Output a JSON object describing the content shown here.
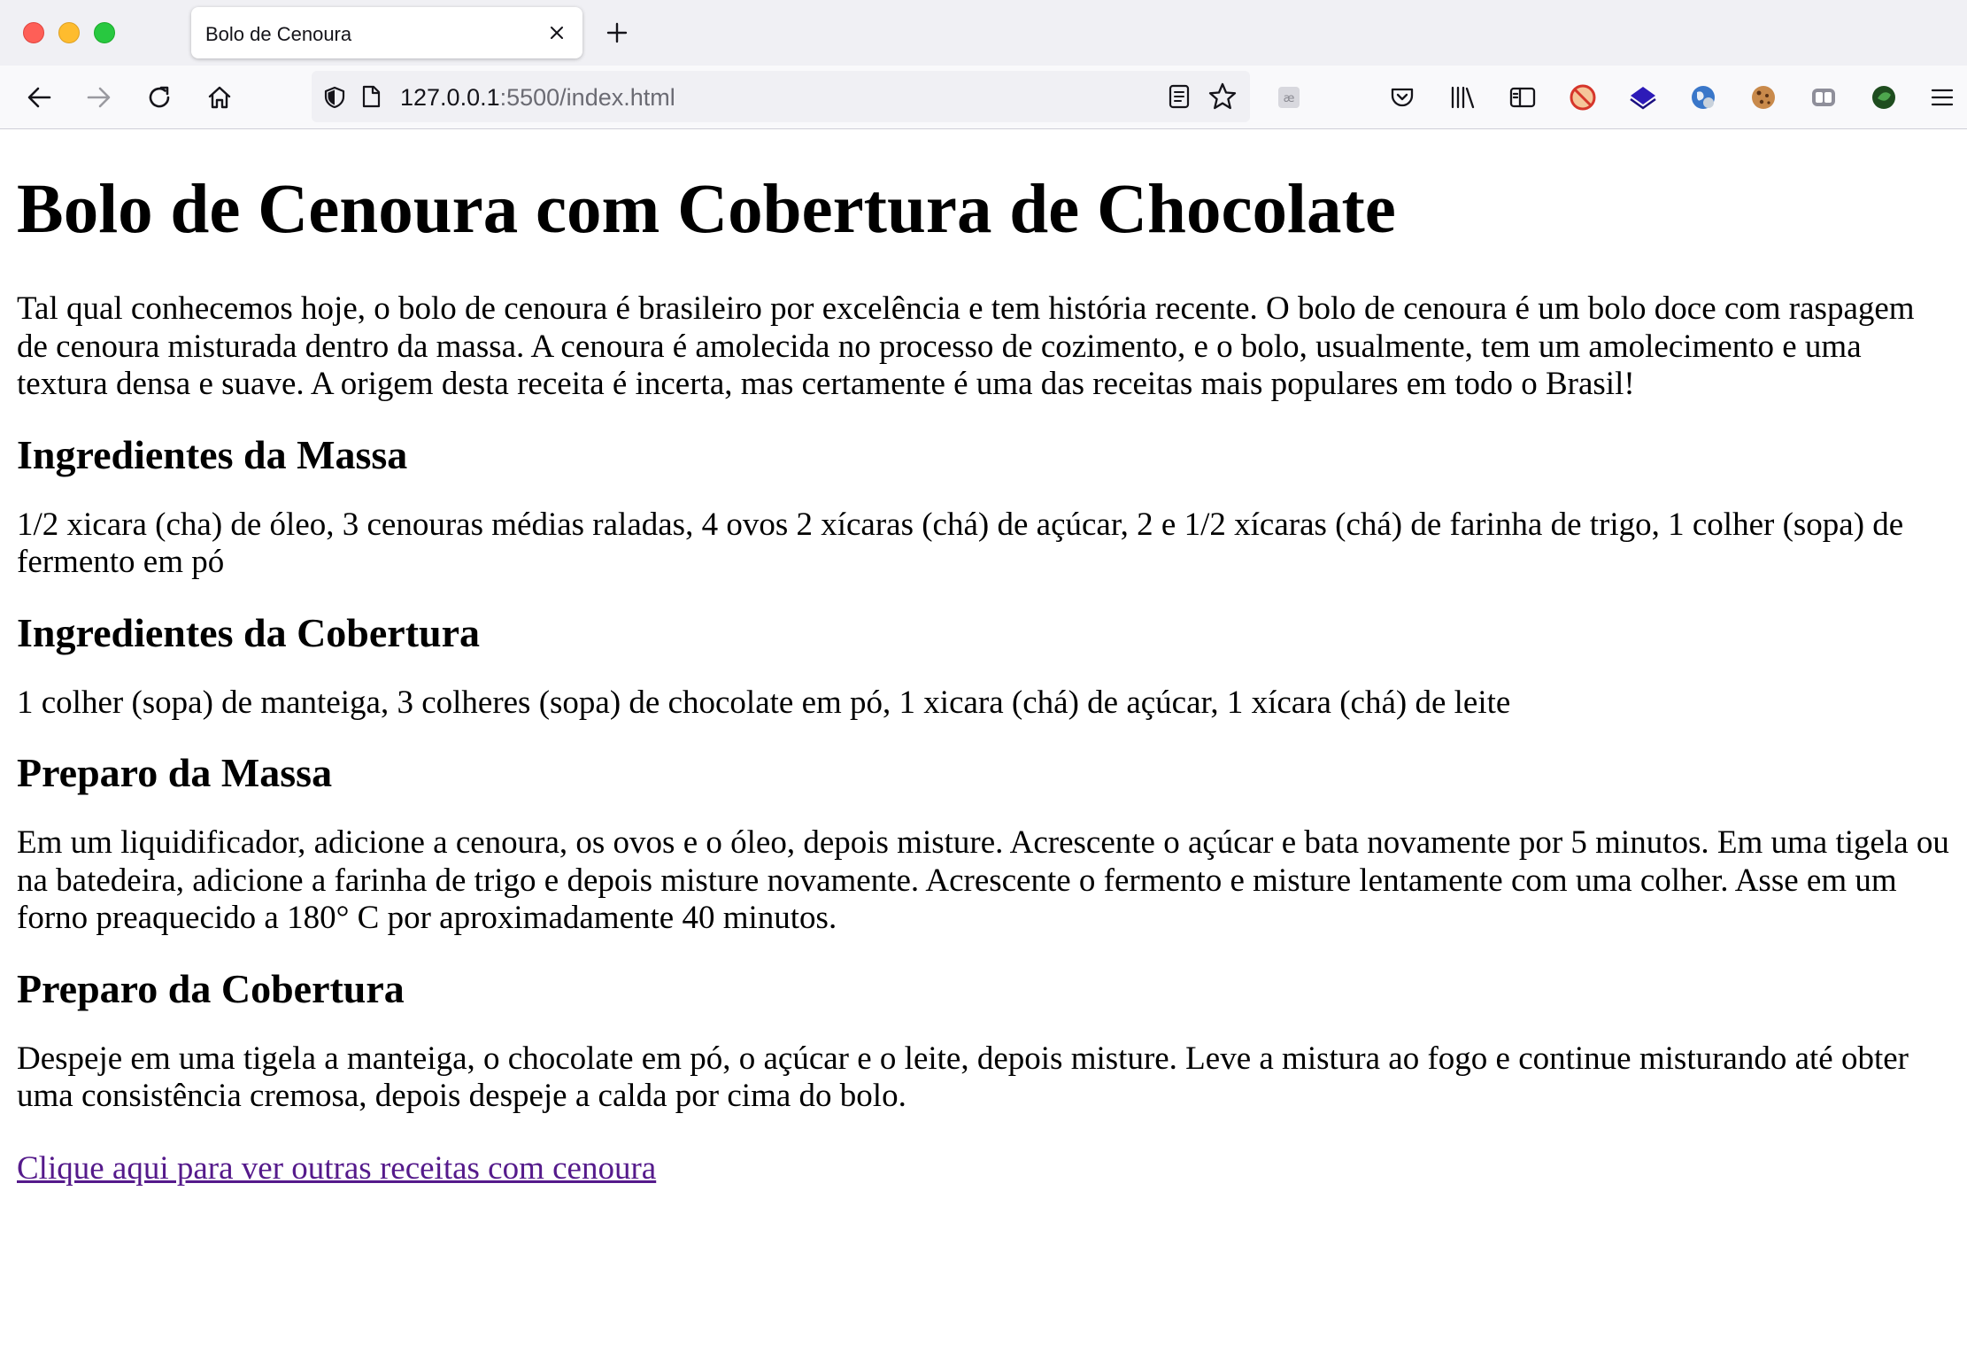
{
  "browser": {
    "tab_title": "Bolo de Cenoura",
    "url_host": "127.0.0.1",
    "url_rest": ":5500/index.html"
  },
  "page": {
    "title": "Bolo de Cenoura com Cobertura de Chocolate",
    "intro": "Tal qual conhecemos hoje, o bolo de cenoura é brasileiro por excelência e tem história recente. O bolo de cenoura é um bolo doce com raspagem de cenoura misturada dentro da massa. A cenoura é amolecida no processo de cozimento, e o bolo, usualmente, tem um amolecimento e uma textura densa e suave. A origem desta receita é incerta, mas certamente é uma das receitas mais populares em todo o Brasil!",
    "sections": [
      {
        "heading": "Ingredientes da Massa",
        "text": "1/2 xicara (cha) de óleo, 3 cenouras médias raladas, 4 ovos 2 xícaras (chá) de açúcar, 2 e 1/2 xícaras (chá) de farinha de trigo, 1 colher (sopa) de fermento em pó"
      },
      {
        "heading": "Ingredientes da Cobertura",
        "text": "1 colher (sopa) de manteiga, 3 colheres (sopa) de chocolate em pó, 1 xicara (chá) de açúcar, 1 xícara (chá) de leite"
      },
      {
        "heading": "Preparo da Massa",
        "text": "Em um liquidificador, adicione a cenoura, os ovos e o óleo, depois misture. Acrescente o açúcar e bata novamente por 5 minutos. Em uma tigela ou na batedeira, adicione a farinha de trigo e depois misture novamente. Acrescente o fermento e misture lentamente com uma colher. Asse em um forno preaquecido a 180° C por aproximadamente 40 minutos."
      },
      {
        "heading": "Preparo da Cobertura",
        "text": "Despeje em uma tigela a manteiga, o chocolate em pó, o açúcar e o leite, depois misture. Leve a mistura ao fogo e continue misturando até obter uma consistência cremosa, depois despeje a calda por cima do bolo."
      }
    ],
    "link_text": "Clique aqui para ver outras receitas com cenoura"
  },
  "colors": {
    "link": "#551a8b",
    "tab_bar": "#f0f0f4",
    "nav_bar": "#f9f9fb"
  }
}
